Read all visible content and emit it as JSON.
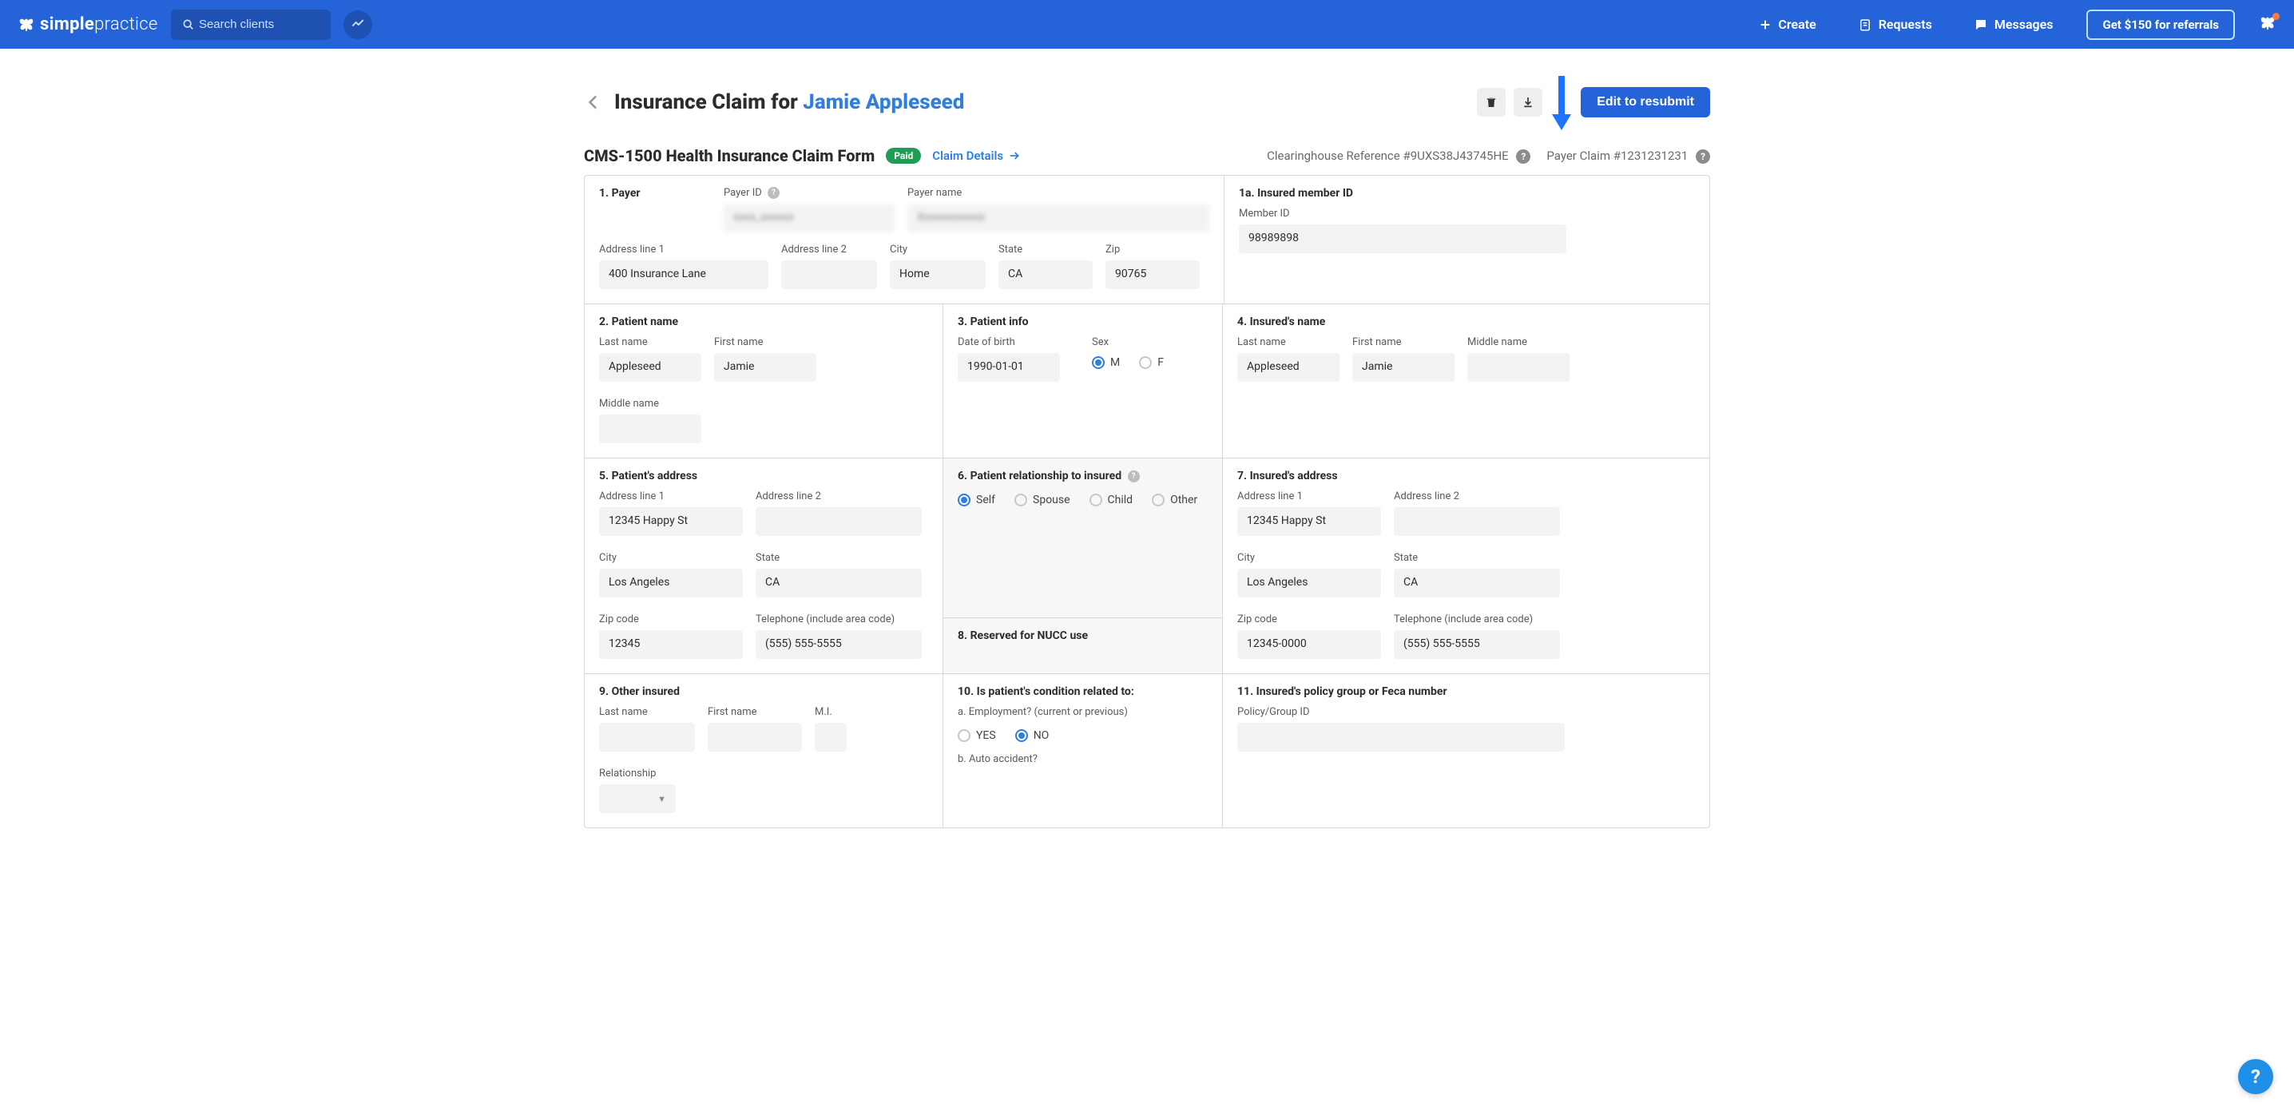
{
  "topbar": {
    "brand_strong": "simple",
    "brand_light": "practice",
    "search_placeholder": "Search clients",
    "nav": {
      "create": "Create",
      "requests": "Requests",
      "messages": "Messages",
      "referral": "Get $150 for referrals"
    }
  },
  "page": {
    "title_prefix": "Insurance Claim for ",
    "client_name": "Jamie Appleseed",
    "edit_btn": "Edit to resubmit"
  },
  "subhead": {
    "form_name": "CMS-1500 Health Insurance Claim Form",
    "status": "Paid",
    "details_link": "Claim Details",
    "clearinghouse_label": "Clearinghouse Reference #",
    "clearinghouse_ref": "9UXS38J43745HE",
    "payer_claim_label": "Payer Claim #",
    "payer_claim_ref": "1231231231"
  },
  "s1": {
    "title": "1. Payer",
    "payer_id_label": "Payer ID",
    "payer_id": "xxxx_xxxxxx",
    "payer_name_label": "Payer name",
    "payer_name": "Xxxxxxxxxxxx",
    "addr1_label": "Address line 1",
    "addr1": "400 Insurance Lane",
    "addr2_label": "Address line 2",
    "addr2": "",
    "city_label": "City",
    "city": "Home",
    "state_label": "State",
    "state": "CA",
    "zip_label": "Zip",
    "zip": "90765"
  },
  "s1a": {
    "title": "1a. Insured member ID",
    "member_label": "Member ID",
    "member_id": "98989898"
  },
  "s2": {
    "title": "2. Patient name",
    "last_label": "Last name",
    "last": "Appleseed",
    "first_label": "First name",
    "first": "Jamie",
    "mid_label": "Middle name",
    "mid": ""
  },
  "s3": {
    "title": "3. Patient info",
    "dob_label": "Date of birth",
    "dob": "1990-01-01",
    "sex_label": "Sex",
    "sex_m": "M",
    "sex_f": "F",
    "sex_selected": "M"
  },
  "s4": {
    "title": "4. Insured's name",
    "last_label": "Last name",
    "last": "Appleseed",
    "first_label": "First name",
    "first": "Jamie",
    "mid_label": "Middle name",
    "mid": ""
  },
  "s5": {
    "title": "5. Patient's address",
    "addr1_label": "Address line 1",
    "addr1": "12345 Happy St",
    "addr2_label": "Address line 2",
    "addr2": "",
    "city_label": "City",
    "city": "Los Angeles",
    "state_label": "State",
    "state": "CA",
    "zip_label": "Zip code",
    "zip": "12345",
    "phone_label": "Telephone (include area code)",
    "phone": "(555) 555-5555"
  },
  "s6": {
    "title": "6. Patient relationship to insured",
    "self": "Self",
    "spouse": "Spouse",
    "child": "Child",
    "other": "Other",
    "selected": "Self"
  },
  "s7": {
    "title": "7. Insured's address",
    "addr1_label": "Address line 1",
    "addr1": "12345 Happy St",
    "addr2_label": "Address line 2",
    "addr2": "",
    "city_label": "City",
    "city": "Los Angeles",
    "state_label": "State",
    "state": "CA",
    "zip_label": "Zip code",
    "zip": "12345-0000",
    "phone_label": "Telephone (include area code)",
    "phone": "(555) 555-5555"
  },
  "s8": {
    "title": "8. Reserved for NUCC use"
  },
  "s9": {
    "title": "9. Other insured",
    "last_label": "Last name",
    "first_label": "First name",
    "mi_label": "M.I.",
    "rel_label": "Relationship"
  },
  "s10": {
    "title": "10. Is patient's condition related to:",
    "a_label": "a. Employment? (current or previous)",
    "yes": "YES",
    "no": "NO",
    "a_selected": "NO",
    "b_label": "b. Auto accident?"
  },
  "s11": {
    "title": "11. Insured's policy group or Feca number",
    "policy_label": "Policy/Group ID",
    "policy": ""
  }
}
